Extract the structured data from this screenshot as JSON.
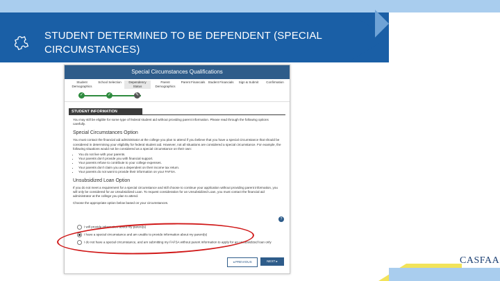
{
  "slide": {
    "title": "STUDENT DETERMINED TO BE DEPENDENT (SPECIAL CIRCUMSTANCES)",
    "logo_text": "CASFAA",
    "colors": {
      "banner": "#1a5fa6",
      "accent_stripe": "#a9cdee",
      "yellow": "#f2e35a",
      "highlight": "#d01818"
    }
  },
  "screen": {
    "header_title": "Special Circumstances Qualifications",
    "steps": [
      {
        "label": "Student Demographics",
        "status": "done"
      },
      {
        "label": "School Selection",
        "status": "done"
      },
      {
        "label": "Dependency Status",
        "status": "current"
      },
      {
        "label": "Parent Demographics",
        "status": "pending"
      },
      {
        "label": "Parent Financials",
        "status": "pending"
      },
      {
        "label": "Student Financials",
        "status": "pending"
      },
      {
        "label": "Sign & Submit",
        "status": "pending"
      },
      {
        "label": "Confirmation",
        "status": "pending"
      }
    ],
    "section_title": "STUDENT INFORMATION",
    "intro_text": "You may still be eligible for some type of federal student aid without providing parent information. Please read through the following options carefully.",
    "option1_heading": "Special Circumstances Option",
    "option1_text": "You must contact the financial aid administrator at the college you plan to attend if you believe that you have a special circumstance that should be considered in determining your eligibility for federal student aid. However, not all situations are considered a special circumstance. For example, the following situations would not be considered as a special circumstance on their own:",
    "bullets": [
      "You do not live with your parents.",
      "Your parents don't provide you with financial support.",
      "Your parents refuse to contribute to your college expenses.",
      "Your parents don't claim you as a dependent on their income tax return.",
      "Your parents do not want to provide their information on your FAFSA."
    ],
    "option2_heading": "Unsubsidized Loan Option",
    "option2_text": "If you do not meet a requirement for a special circumstance and still choose to continue your application without providing parent information, you will only be considered for an Unsubsidized Loan. To request consideration for an Unsubsidized Loan, you must contact the financial aid administrator at the college you plan to attend.",
    "choose_label": "Choose the appropriate option below based on your circumstances.",
    "help_glyph": "?",
    "radios": [
      {
        "label": "I will provide information about my parent(s)",
        "checked": false
      },
      {
        "label": "I have a special circumstance and am unable to provide information about my parent(s)",
        "checked": true
      },
      {
        "label": "I do not have a special circumstance, and am submitting my FAFSA without parent information to apply for an unsubsidized loan only",
        "checked": false
      }
    ],
    "prev_label": "PREVIOUS",
    "next_label": "NEXT"
  }
}
